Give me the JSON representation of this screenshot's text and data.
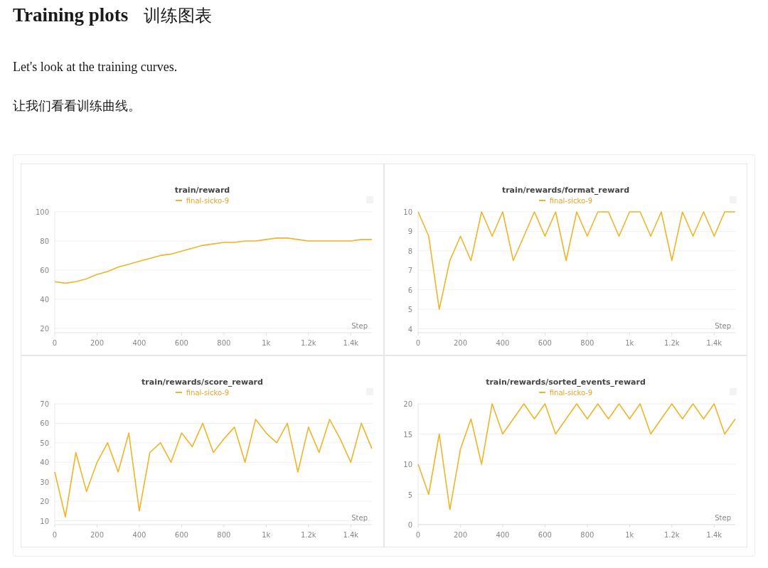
{
  "heading": {
    "title": "Training plots",
    "subtitle": "训练图表"
  },
  "paragraphs": [
    "Let's look at the training curves.",
    "让我们看看训练曲线。"
  ],
  "panels": [
    {
      "chart_data": {
        "type": "line",
        "grid": true,
        "title": "train/reward",
        "xlabel": "Step",
        "x": [
          0,
          50,
          100,
          150,
          200,
          250,
          300,
          350,
          400,
          450,
          500,
          550,
          600,
          650,
          700,
          750,
          800,
          850,
          900,
          950,
          1000,
          1050,
          1100,
          1150,
          1200,
          1250,
          1300,
          1350,
          1400,
          1450,
          1500
        ],
        "xlim": [
          0,
          1500
        ],
        "ylim": [
          17,
          100
        ],
        "xticks": [
          0,
          200,
          400,
          600,
          800,
          {
            "value": 1000,
            "label": "1k"
          },
          {
            "value": 1200,
            "label": "1.2k"
          },
          {
            "value": 1400,
            "label": "1.4k"
          }
        ],
        "yticks": [
          20,
          40,
          60,
          80,
          100
        ],
        "series": [
          {
            "name": "final-sicko-9",
            "color": "#f0b429",
            "values": [
              52,
              51,
              52,
              54,
              57,
              59,
              62,
              64,
              66,
              68,
              70,
              71,
              73,
              75,
              77,
              78,
              79,
              79,
              80,
              80,
              81,
              82,
              82,
              81,
              80,
              80,
              80,
              80,
              80,
              81,
              81
            ]
          }
        ]
      }
    },
    {
      "chart_data": {
        "type": "line",
        "grid": true,
        "title": "train/rewards/format_reward",
        "xlabel": "Step",
        "x": [
          0,
          50,
          100,
          150,
          200,
          250,
          300,
          350,
          400,
          450,
          500,
          550,
          600,
          650,
          700,
          750,
          800,
          850,
          900,
          950,
          1000,
          1050,
          1100,
          1150,
          1200,
          1250,
          1300,
          1350,
          1400,
          1450,
          1500
        ],
        "xlim": [
          0,
          1500
        ],
        "ylim": [
          3.8,
          10
        ],
        "xticks": [
          0,
          200,
          400,
          600,
          800,
          {
            "value": 1000,
            "label": "1k"
          },
          {
            "value": 1200,
            "label": "1.2k"
          },
          {
            "value": 1400,
            "label": "1.4k"
          }
        ],
        "yticks": [
          4,
          5,
          6,
          7,
          8,
          9,
          10
        ],
        "series": [
          {
            "name": "final-sicko-9",
            "color": "#f0b429",
            "values": [
              10,
              8.75,
              5,
              7.5,
              8.75,
              7.5,
              10,
              8.75,
              10,
              7.5,
              8.75,
              10,
              8.75,
              10,
              7.5,
              10,
              8.75,
              10,
              10,
              8.75,
              10,
              10,
              8.75,
              10,
              7.5,
              10,
              8.75,
              10,
              8.75,
              10,
              10
            ]
          }
        ]
      }
    },
    {
      "chart_data": {
        "type": "line",
        "grid": true,
        "title": "train/rewards/score_reward",
        "xlabel": "Step",
        "x": [
          0,
          50,
          100,
          150,
          200,
          250,
          300,
          350,
          400,
          450,
          500,
          550,
          600,
          650,
          700,
          750,
          800,
          850,
          900,
          950,
          1000,
          1050,
          1100,
          1150,
          1200,
          1250,
          1300,
          1350,
          1400,
          1450,
          1500
        ],
        "xlim": [
          0,
          1500
        ],
        "ylim": [
          8,
          70
        ],
        "xticks": [
          0,
          200,
          400,
          600,
          800,
          {
            "value": 1000,
            "label": "1k"
          },
          {
            "value": 1200,
            "label": "1.2k"
          },
          {
            "value": 1400,
            "label": "1.4k"
          }
        ],
        "yticks": [
          10,
          20,
          30,
          40,
          50,
          60,
          70
        ],
        "series": [
          {
            "name": "final-sicko-9",
            "color": "#f0b429",
            "values": [
              35,
              12,
              45,
              25,
              40,
              50,
              35,
              55,
              15,
              45,
              50,
              40,
              55,
              48,
              60,
              45,
              52,
              58,
              40,
              62,
              55,
              50,
              60,
              35,
              58,
              45,
              62,
              52,
              40,
              60,
              47
            ]
          }
        ]
      }
    },
    {
      "chart_data": {
        "type": "line",
        "grid": true,
        "title": "train/rewards/sorted_events_reward",
        "xlabel": "Step",
        "x": [
          0,
          50,
          100,
          150,
          200,
          250,
          300,
          350,
          400,
          450,
          500,
          550,
          600,
          650,
          700,
          750,
          800,
          850,
          900,
          950,
          1000,
          1050,
          1100,
          1150,
          1200,
          1250,
          1300,
          1350,
          1400,
          1450,
          1500
        ],
        "xlim": [
          0,
          1500
        ],
        "ylim": [
          0,
          20
        ],
        "xticks": [
          0,
          200,
          400,
          600,
          800,
          {
            "value": 1000,
            "label": "1k"
          },
          {
            "value": 1200,
            "label": "1.2k"
          },
          {
            "value": 1400,
            "label": "1.4k"
          }
        ],
        "yticks": [
          0,
          5,
          10,
          15,
          20
        ],
        "series": [
          {
            "name": "final-sicko-9",
            "color": "#f0b429",
            "values": [
              10,
              5,
              15,
              2.5,
              12.5,
              17.5,
              10,
              20,
              15,
              17.5,
              20,
              17.5,
              20,
              15,
              17.5,
              20,
              17.5,
              20,
              17.5,
              20,
              17.5,
              20,
              15,
              17.5,
              20,
              17.5,
              20,
              17.5,
              20,
              15,
              17.5
            ]
          }
        ]
      }
    }
  ]
}
